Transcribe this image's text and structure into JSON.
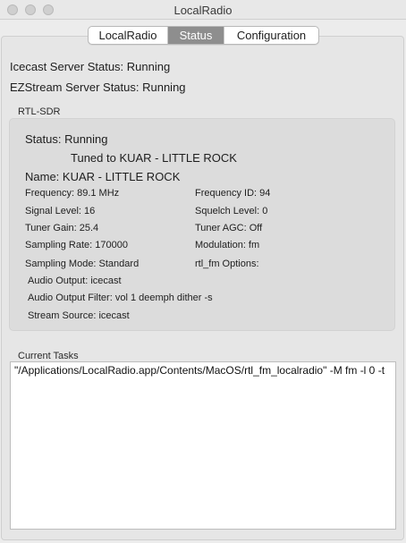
{
  "window": {
    "title": "LocalRadio"
  },
  "tabs": [
    {
      "label": "LocalRadio",
      "selected": false
    },
    {
      "label": "Status",
      "selected": true
    },
    {
      "label": "Configuration",
      "selected": false
    }
  ],
  "server_status": {
    "icecast": "Icecast Server Status:  Running",
    "ezstream": "EZStream Server Status:  Running"
  },
  "rtl_sdr": {
    "group_title": "RTL-SDR",
    "status": "Status:  Running",
    "tuned": "Tuned to KUAR - LITTLE ROCK",
    "name": "Name:  KUAR - LITTLE ROCK",
    "frequency": "Frequency:  89.1 MHz",
    "frequency_id": "Frequency ID:  94",
    "signal_level": "Signal Level:   16",
    "squelch_level": "Squelch Level:  0",
    "tuner_gain": "Tuner Gain:  25.4",
    "tuner_agc": "Tuner AGC:  Off",
    "sampling_rate": "Sampling Rate:  170000",
    "modulation": "Modulation:  fm",
    "sampling_mode": "Sampling Mode:  Standard",
    "rtl_fm_options": "rtl_fm Options:",
    "audio_output": "Audio Output:  icecast",
    "audio_output_filter": "Audio Output Filter:  vol 1 deemph dither -s",
    "stream_source": "Stream Source:  icecast"
  },
  "current_tasks": {
    "title": "Current Tasks",
    "text": "\"/Applications/LocalRadio.app/Contents/MacOS/rtl_fm_localradio\" -M fm -l 0 -t"
  }
}
